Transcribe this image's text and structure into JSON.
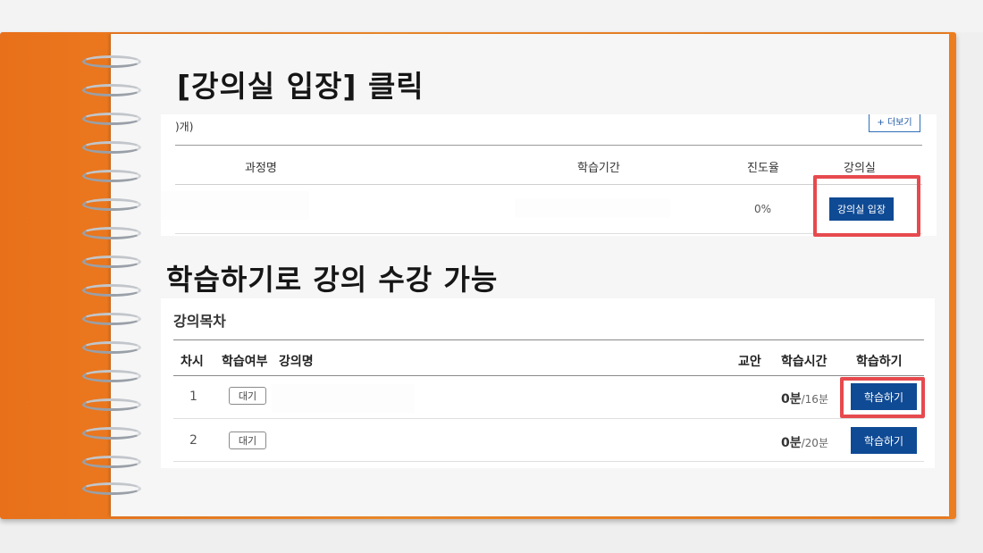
{
  "headline_enter": "[강의실 입장] 클릭",
  "headline_study": "학습하기로 강의 수강 가능",
  "course_panel": {
    "count_label": ")개)",
    "more_button": "+ 더보기",
    "columns": {
      "course_name": "과정명",
      "period": "학습기간",
      "progress": "진도율",
      "classroom": "강의실"
    },
    "row": {
      "progress": "0%",
      "enter_button": "강의실 입장"
    }
  },
  "toc_panel": {
    "title": "강의목차",
    "columns": {
      "session": "차시",
      "status": "학습여부",
      "lecture_name": "강의명",
      "material": "교안",
      "study_time": "학습시간",
      "study": "학습하기"
    },
    "rows": [
      {
        "session": "1",
        "status": "대기",
        "time_done": "0분",
        "time_total": "/16분",
        "button": "학습하기"
      },
      {
        "session": "2",
        "status": "대기",
        "time_done": "0분",
        "time_total": "/20분",
        "button": "학습하기"
      }
    ]
  },
  "colors": {
    "cover_orange": "#ec7d20",
    "button_blue": "#0f4a94",
    "highlight_red": "#e64a4e"
  }
}
